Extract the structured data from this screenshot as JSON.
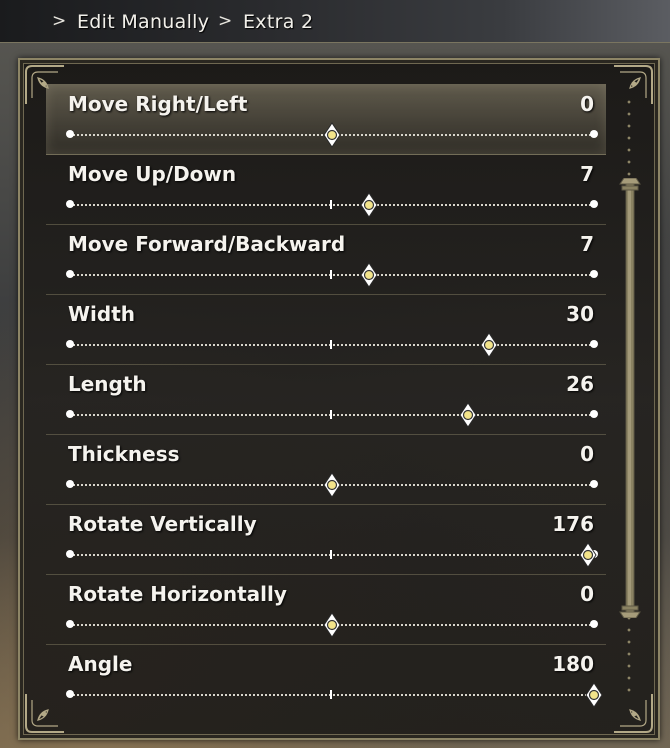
{
  "breadcrumb": {
    "separator": ">",
    "items": [
      "Edit Manually",
      "Extra 2"
    ]
  },
  "sliders": [
    {
      "label": "Move Right/Left",
      "value": "0",
      "position": 0.5,
      "selected": true
    },
    {
      "label": "Move Up/Down",
      "value": "7",
      "position": 0.57,
      "selected": false
    },
    {
      "label": "Move Forward/Backward",
      "value": "7",
      "position": 0.57,
      "selected": false
    },
    {
      "label": "Width",
      "value": "30",
      "position": 0.8,
      "selected": false
    },
    {
      "label": "Length",
      "value": "26",
      "position": 0.76,
      "selected": false
    },
    {
      "label": "Thickness",
      "value": "0",
      "position": 0.5,
      "selected": false
    },
    {
      "label": "Rotate Vertically",
      "value": "176",
      "position": 0.989,
      "selected": false
    },
    {
      "label": "Rotate Horizontally",
      "value": "0",
      "position": 0.5,
      "selected": false
    },
    {
      "label": "Angle",
      "value": "180",
      "position": 1.0,
      "selected": false
    }
  ],
  "colors": {
    "text": "#f5f3ee",
    "frame": "#8d8566",
    "handle_fill": "#f2e38a",
    "selected_row": "#968e76"
  },
  "icons": {
    "slider_handle": "diamond-handle-icon",
    "corner": "ornate-corner-icon"
  }
}
